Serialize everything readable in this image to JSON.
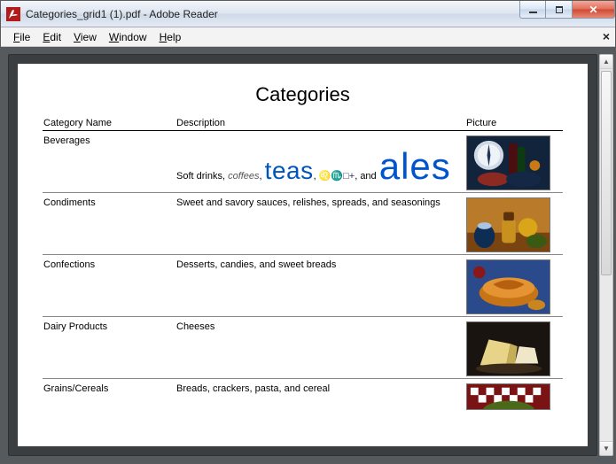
{
  "window": {
    "title": "Categories_grid1 (1).pdf - Adobe Reader"
  },
  "menu": {
    "file": "File",
    "edit": "Edit",
    "view": "View",
    "window": "Window",
    "help": "Help"
  },
  "doc": {
    "title": "Categories",
    "headers": {
      "name": "Category Name",
      "desc": "Description",
      "pic": "Picture"
    },
    "rows": [
      {
        "name": "Beverages",
        "desc_parts": {
          "soft": "Soft drinks, ",
          "coffees": "coffees",
          "comma": ", ",
          "teas": "teas",
          "sep1": ", ",
          "symbols": "♌♏□+",
          "sep2": ", and ",
          "ales": "ales"
        }
      },
      {
        "name": "Condiments",
        "desc": "Sweet and savory sauces, relishes, spreads, and seasonings"
      },
      {
        "name": "Confections",
        "desc": "Desserts, candies, and sweet breads"
      },
      {
        "name": "Dairy Products",
        "desc": "Cheeses"
      },
      {
        "name": "Grains/Cereals",
        "desc": "Breads, crackers, pasta, and cereal"
      }
    ]
  }
}
